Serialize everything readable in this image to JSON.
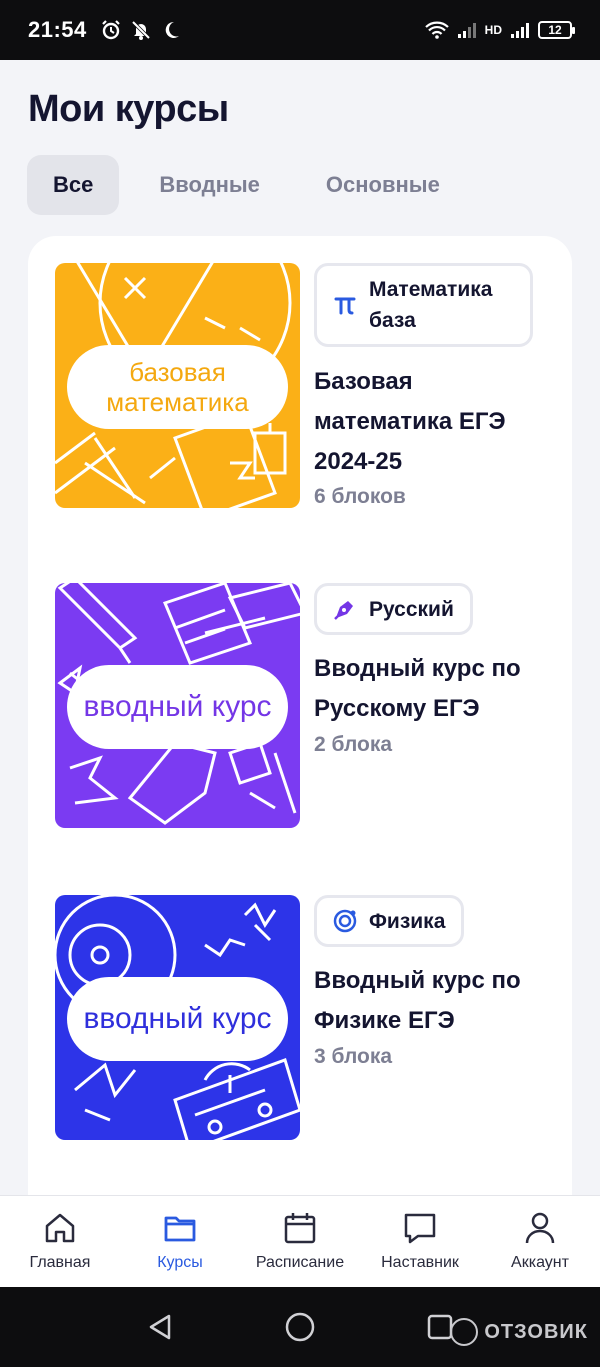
{
  "status": {
    "time": "21:54",
    "network": "HD",
    "battery": "12",
    "icons": [
      "alarm-icon",
      "mute-icon",
      "moon-icon",
      "wifi-icon",
      "signal-icon",
      "battery-icon"
    ]
  },
  "page": {
    "title": "Мои курсы"
  },
  "tabs": [
    {
      "label": "Все",
      "active": true
    },
    {
      "label": "Вводные",
      "active": false
    },
    {
      "label": "Основные",
      "active": false
    }
  ],
  "courses": [
    {
      "thumb_label": "базовая математика",
      "thumb_color": "#fbb017",
      "subject": "Математика база",
      "subject_icon": "pi-icon",
      "title": "Базовая математика ЕГЭ 2024-25",
      "meta": "6 блоков"
    },
    {
      "thumb_label": "вводный курс",
      "thumb_color": "#7b3bf2",
      "subject": "Русский",
      "subject_icon": "pen-icon",
      "title": "Вводный курс по Русскому ЕГЭ",
      "meta": "2 блока"
    },
    {
      "thumb_label": "вводный курс",
      "thumb_color": "#2d34e8",
      "subject": "Физика",
      "subject_icon": "atom-icon",
      "title": "Вводный курс по Физике ЕГЭ",
      "meta": "3 блока"
    }
  ],
  "nav": [
    {
      "label": "Главная",
      "icon": "home-icon",
      "active": false
    },
    {
      "label": "Курсы",
      "icon": "folder-icon",
      "active": true
    },
    {
      "label": "Расписание",
      "icon": "calendar-icon",
      "active": false
    },
    {
      "label": "Наставник",
      "icon": "chat-icon",
      "active": false
    },
    {
      "label": "Аккаунт",
      "icon": "user-icon",
      "active": false
    }
  ],
  "watermark": "ОТЗОВИК",
  "colors": {
    "accent": "#2a5ae0",
    "text": "#141530",
    "muted": "#7d7f93"
  }
}
